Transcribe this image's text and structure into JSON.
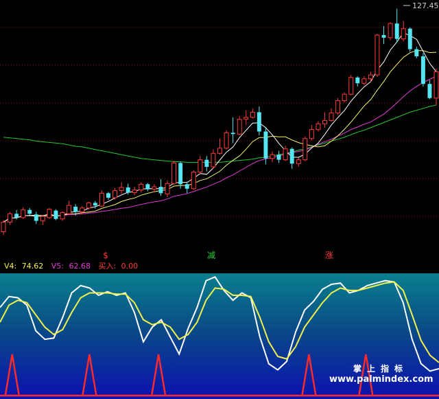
{
  "chart_data": [
    {
      "type": "candlestick",
      "price_label": "127.45",
      "ylim": [
        92,
        128
      ],
      "grid": "dotted horizontal",
      "colors": {
        "up": "#ff3b3b",
        "down": "#55e6f2",
        "ma5": "#ffffff",
        "ma10": "#f5f56e",
        "ma20": "#e23bd8",
        "ma60": "#22c832",
        "grid": "#8a1111"
      },
      "candles": [
        {
          "o": 92.8,
          "h": 94.6,
          "l": 92.3,
          "c": 94.3
        },
        {
          "o": 94.3,
          "h": 95.9,
          "l": 93.9,
          "c": 95.6
        },
        {
          "o": 95.6,
          "h": 96.2,
          "l": 94.7,
          "c": 95.0
        },
        {
          "o": 95.0,
          "h": 96.6,
          "l": 94.8,
          "c": 96.2
        },
        {
          "o": 96.2,
          "h": 96.5,
          "l": 95.2,
          "c": 95.6
        },
        {
          "o": 95.5,
          "h": 95.9,
          "l": 94.0,
          "c": 94.5
        },
        {
          "o": 94.5,
          "h": 95.4,
          "l": 93.9,
          "c": 95.2
        },
        {
          "o": 95.0,
          "h": 96.5,
          "l": 94.8,
          "c": 96.3
        },
        {
          "o": 96.1,
          "h": 96.3,
          "l": 94.6,
          "c": 94.8
        },
        {
          "o": 94.8,
          "h": 96.0,
          "l": 94.5,
          "c": 95.8
        },
        {
          "o": 95.6,
          "h": 97.6,
          "l": 95.4,
          "c": 96.9
        },
        {
          "o": 96.7,
          "h": 97.1,
          "l": 95.3,
          "c": 95.9
        },
        {
          "o": 95.9,
          "h": 96.8,
          "l": 95.5,
          "c": 96.5
        },
        {
          "o": 96.5,
          "h": 97.5,
          "l": 96.2,
          "c": 97.3
        },
        {
          "o": 97.3,
          "h": 97.6,
          "l": 96.4,
          "c": 96.9
        },
        {
          "o": 96.8,
          "h": 99.2,
          "l": 96.7,
          "c": 98.8
        },
        {
          "o": 98.8,
          "h": 99.0,
          "l": 97.8,
          "c": 98.1
        },
        {
          "o": 98.1,
          "h": 99.6,
          "l": 97.8,
          "c": 99.2
        },
        {
          "o": 99.2,
          "h": 100.5,
          "l": 98.7,
          "c": 99.7
        },
        {
          "o": 99.7,
          "h": 100.3,
          "l": 98.6,
          "c": 98.9
        },
        {
          "o": 98.9,
          "h": 99.8,
          "l": 98.5,
          "c": 99.3
        },
        {
          "o": 99.3,
          "h": 100.5,
          "l": 98.9,
          "c": 100.2
        },
        {
          "o": 100.2,
          "h": 100.4,
          "l": 99.1,
          "c": 99.4
        },
        {
          "o": 99.4,
          "h": 100.2,
          "l": 99.0,
          "c": 99.8
        },
        {
          "o": 99.8,
          "h": 101.0,
          "l": 98.4,
          "c": 98.8
        },
        {
          "o": 98.7,
          "h": 100.8,
          "l": 98.2,
          "c": 100.3
        },
        {
          "o": 100.3,
          "h": 103.9,
          "l": 100.1,
          "c": 103.5
        },
        {
          "o": 103.5,
          "h": 103.7,
          "l": 99.5,
          "c": 100.2
        },
        {
          "o": 100.2,
          "h": 100.6,
          "l": 98.8,
          "c": 99.5
        },
        {
          "o": 99.5,
          "h": 102.4,
          "l": 99.3,
          "c": 102.1
        },
        {
          "o": 102.1,
          "h": 104.6,
          "l": 101.8,
          "c": 104.0
        },
        {
          "o": 104.0,
          "h": 104.6,
          "l": 102.2,
          "c": 102.9
        },
        {
          "o": 102.9,
          "h": 105.6,
          "l": 102.6,
          "c": 105.0
        },
        {
          "o": 105.0,
          "h": 107.3,
          "l": 104.8,
          "c": 105.8
        },
        {
          "o": 105.8,
          "h": 108.6,
          "l": 105.6,
          "c": 108.2
        },
        {
          "o": 108.2,
          "h": 110.6,
          "l": 106.6,
          "c": 108.0
        },
        {
          "o": 108.0,
          "h": 110.8,
          "l": 107.8,
          "c": 110.3
        },
        {
          "o": 110.3,
          "h": 111.7,
          "l": 109.4,
          "c": 110.6
        },
        {
          "o": 110.6,
          "h": 112.0,
          "l": 110.4,
          "c": 111.4
        },
        {
          "o": 111.4,
          "h": 112.3,
          "l": 107.8,
          "c": 108.4
        },
        {
          "o": 108.4,
          "h": 109.1,
          "l": 103.3,
          "c": 104.2
        },
        {
          "o": 104.2,
          "h": 105.3,
          "l": 103.6,
          "c": 104.8
        },
        {
          "o": 104.8,
          "h": 105.4,
          "l": 103.5,
          "c": 104.0
        },
        {
          "o": 104.0,
          "h": 106.2,
          "l": 103.8,
          "c": 105.7
        },
        {
          "o": 105.7,
          "h": 105.9,
          "l": 102.6,
          "c": 103.4
        },
        {
          "o": 103.4,
          "h": 104.3,
          "l": 102.9,
          "c": 104.0
        },
        {
          "o": 104.0,
          "h": 107.6,
          "l": 103.8,
          "c": 107.3
        },
        {
          "o": 107.3,
          "h": 109.4,
          "l": 107.0,
          "c": 108.7
        },
        {
          "o": 108.7,
          "h": 110.0,
          "l": 108.4,
          "c": 109.6
        },
        {
          "o": 109.6,
          "h": 111.4,
          "l": 109.0,
          "c": 110.1
        },
        {
          "o": 110.1,
          "h": 112.0,
          "l": 109.9,
          "c": 111.3
        },
        {
          "o": 111.3,
          "h": 113.6,
          "l": 111.0,
          "c": 113.2
        },
        {
          "o": 113.2,
          "h": 114.5,
          "l": 112.9,
          "c": 114.2
        },
        {
          "o": 114.2,
          "h": 117.2,
          "l": 114.0,
          "c": 116.8
        },
        {
          "o": 116.8,
          "h": 117.0,
          "l": 115.4,
          "c": 115.9
        },
        {
          "o": 115.9,
          "h": 117.0,
          "l": 115.6,
          "c": 116.6
        },
        {
          "o": 116.6,
          "h": 117.7,
          "l": 116.1,
          "c": 117.2
        },
        {
          "o": 117.2,
          "h": 123.6,
          "l": 116.9,
          "c": 123.4
        },
        {
          "o": 123.4,
          "h": 124.8,
          "l": 122.0,
          "c": 123.0
        },
        {
          "o": 123.0,
          "h": 125.4,
          "l": 122.6,
          "c": 125.2
        },
        {
          "o": 125.2,
          "h": 127.5,
          "l": 122.2,
          "c": 122.8
        },
        {
          "o": 122.8,
          "h": 125.6,
          "l": 122.4,
          "c": 124.4
        },
        {
          "o": 124.4,
          "h": 124.6,
          "l": 120.8,
          "c": 121.2
        },
        {
          "o": 121.2,
          "h": 121.6,
          "l": 119.8,
          "c": 120.1
        },
        {
          "o": 120.1,
          "h": 120.6,
          "l": 115.4,
          "c": 115.8
        },
        {
          "o": 115.8,
          "h": 116.4,
          "l": 113.4,
          "c": 113.6
        },
        {
          "o": 113.6,
          "h": 118.2,
          "l": 112.5,
          "c": 117.7
        }
      ],
      "ma60": [
        107.5,
        107.4,
        107.3,
        107.2,
        107.1,
        106.9,
        106.8,
        106.7,
        106.6,
        106.5,
        106.3,
        106.1,
        106.0,
        105.8,
        105.6,
        105.4,
        105.2,
        105.0,
        104.8,
        104.6,
        104.4,
        104.2,
        104.1,
        104.0,
        103.9,
        103.8,
        103.7,
        103.7,
        103.6,
        103.6,
        103.6,
        103.6,
        103.6,
        103.6,
        103.7,
        103.8,
        103.9,
        104.0,
        104.1,
        104.3,
        104.4,
        104.6,
        104.8,
        105.0,
        105.2,
        105.5,
        105.7,
        106.0,
        106.3,
        106.6,
        106.9,
        107.2,
        107.5,
        107.9,
        108.3,
        108.6,
        109.0,
        109.4,
        109.8,
        110.2,
        110.6,
        111.0,
        111.4,
        111.7,
        112.0,
        112.3,
        112.5
      ],
      "markers": [
        {
          "index": 26,
          "label": "$",
          "color": "#ff3b3b"
        },
        {
          "index": 52,
          "label": "减",
          "color": "#22d23c"
        },
        {
          "index": 81,
          "label": "涨",
          "color": "#ff3b3b"
        }
      ]
    },
    {
      "type": "line",
      "legend": [
        {
          "label": "V4: ",
          "value": "74.62",
          "color": "#f2f24a"
        },
        {
          "label": "V5: ",
          "value": "62.68",
          "color": "#e23bd8"
        },
        {
          "label": "买入: ",
          "value": "0.00",
          "color": "#ff3b3b"
        }
      ],
      "ylim": [
        0,
        100
      ],
      "series": [
        {
          "key": "fast",
          "color": "#ffffff",
          "values": [
            72,
            81,
            80,
            74,
            53,
            46,
            47,
            64,
            84,
            90,
            88,
            82,
            85,
            82,
            84,
            68,
            44,
            56,
            62,
            48,
            34,
            55,
            72,
            94,
            97,
            86,
            78,
            84,
            80,
            48,
            26,
            21,
            28,
            52,
            70,
            77,
            87,
            91,
            92,
            84,
            86,
            90,
            92,
            94,
            93,
            76,
            46,
            26,
            20,
            22
          ]
        },
        {
          "key": "slow",
          "color": "#f2f24a",
          "values": [
            60,
            74,
            78,
            76,
            66,
            56,
            50,
            54,
            68,
            80,
            84,
            84,
            84,
            83,
            83,
            76,
            62,
            58,
            60,
            56,
            46,
            50,
            60,
            78,
            88,
            87,
            82,
            82,
            81,
            64,
            44,
            32,
            30,
            40,
            56,
            66,
            76,
            84,
            88,
            86,
            86,
            88,
            90,
            92,
            93,
            86,
            66,
            45,
            33,
            27
          ]
        }
      ],
      "signal_spikes": [
        {
          "index": 3,
          "value": 1
        },
        {
          "index": 22,
          "value": 1
        },
        {
          "index": 39,
          "value": 1
        },
        {
          "index": 76,
          "value": 1
        },
        {
          "index": 90,
          "value": 1
        }
      ]
    }
  ],
  "watermark": {
    "cn": "掌上指标",
    "url": "www.palmindex.com"
  }
}
